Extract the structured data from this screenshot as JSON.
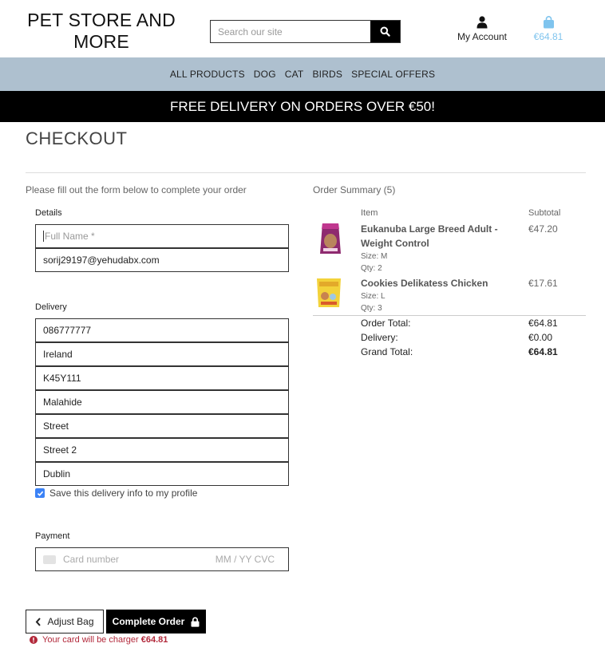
{
  "header": {
    "logo": "PET STORE AND MORE",
    "search_placeholder": "Search our site",
    "account_label": "My Account",
    "bag_total": "€64.81"
  },
  "nav": {
    "items": [
      "ALL PRODUCTS",
      "DOG",
      "CAT",
      "BIRDS",
      "SPECIAL OFFERS"
    ]
  },
  "banner": "FREE DELIVERY ON ORDERS OVER €50!",
  "checkout": {
    "title": "CHECKOUT",
    "intro": "Please fill out the form below to complete your order",
    "details_label": "Details",
    "full_name_placeholder": "Full Name *",
    "email": "sorij29197@yehudabx.com",
    "delivery_label": "Delivery",
    "phone": "086777777",
    "country": "Ireland",
    "postcode": "K45Y111",
    "town": "Malahide",
    "street1": "Street",
    "street2": "Street 2",
    "county": "Dublin",
    "save_info": "Save this delivery info to my profile",
    "payment_label": "Payment",
    "card_placeholder": "Card number",
    "card_expiry_cvc": "MM / YY  CVC",
    "adjust_bag": "Adjust Bag",
    "complete_order": "Complete Order",
    "charge_note": "Your card will be charger",
    "charge_amount": "€64.81"
  },
  "summary": {
    "title": "Order Summary (5)",
    "col_item": "Item",
    "col_subtotal": "Subtotal",
    "items": [
      {
        "name": "Eukanuba Large Breed Adult - Weight Control",
        "size": "Size: M",
        "qty": "Qty: 2",
        "subtotal": "€47.20"
      },
      {
        "name": "Cookies Delikatess Chicken",
        "size": "Size: L",
        "qty": "Qty: 3",
        "subtotal": "€17.61"
      }
    ],
    "order_total_label": "Order Total:",
    "order_total": "€64.81",
    "delivery_label": "Delivery:",
    "delivery": "€0.00",
    "grand_total_label": "Grand Total:",
    "grand_total": "€64.81"
  },
  "colors": {
    "nav_bg": "#aec0cf",
    "bag_accent": "#7fc4ee",
    "error": "#b2283a",
    "checkbox": "#3b82f6"
  }
}
